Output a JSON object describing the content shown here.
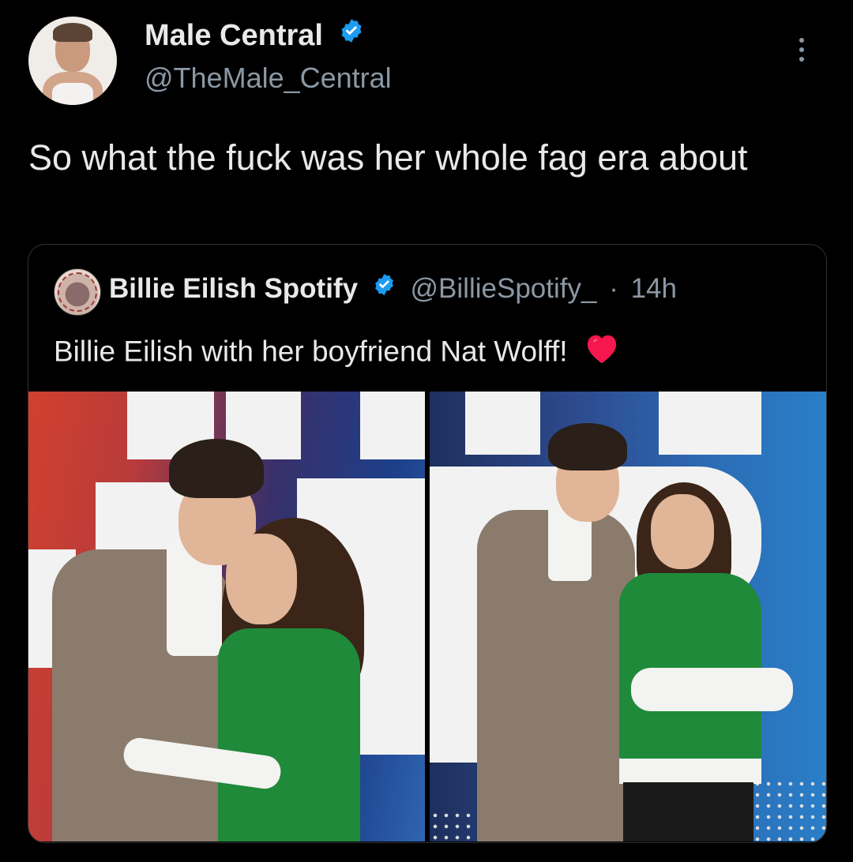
{
  "tweet": {
    "display_name": "Male Central",
    "handle": "@TheMale_Central",
    "text": "So what the fuck was her whole fag era about",
    "verified": true
  },
  "quoted_tweet": {
    "display_name": "Billie Eilish Spotify",
    "handle": "@BillieSpotify_",
    "separator": "·",
    "time": "14h",
    "text": "Billie Eilish with her boyfriend Nat Wolff!",
    "verified": true,
    "emoji": "heart-emoji"
  },
  "icons": {
    "verified": "verified-badge-icon",
    "more": "more-options-icon"
  },
  "colors": {
    "background": "#000000",
    "text_primary": "#e7e9ea",
    "text_secondary": "#8b98a5",
    "verified_blue": "#1d9bf0",
    "border": "#2f3336",
    "heart_red": "#f7174f"
  }
}
